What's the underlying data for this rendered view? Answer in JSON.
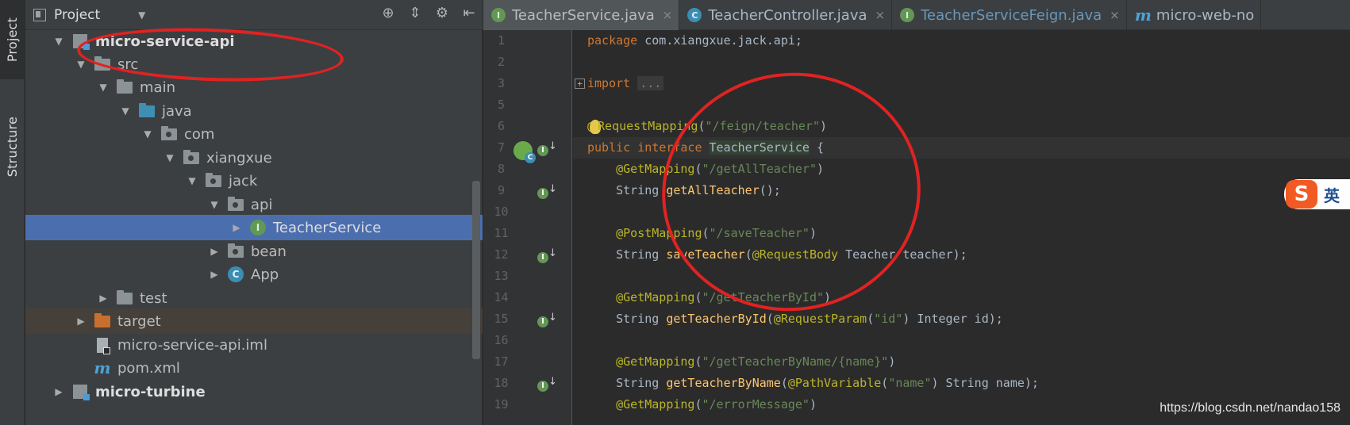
{
  "left_strip": {
    "project_tab": "Project",
    "structure_tab": "Structure"
  },
  "project_panel": {
    "title": "Project",
    "tree": [
      {
        "label": "micro-service-api",
        "icon": "module-folder-icon",
        "expanded": true,
        "bold": true
      },
      {
        "label": "src",
        "icon": "folder-icon",
        "expanded": true
      },
      {
        "label": "main",
        "icon": "folder-icon",
        "expanded": true
      },
      {
        "label": "java",
        "icon": "source-root-folder-icon",
        "expanded": true
      },
      {
        "label": "com",
        "icon": "package-icon",
        "expanded": true
      },
      {
        "label": "xiangxue",
        "icon": "package-icon",
        "expanded": true
      },
      {
        "label": "jack",
        "icon": "package-icon",
        "expanded": true
      },
      {
        "label": "api",
        "icon": "package-icon",
        "expanded": true
      },
      {
        "label": "TeacherService",
        "icon": "interface-icon",
        "selected": true
      },
      {
        "label": "bean",
        "icon": "package-icon"
      },
      {
        "label": "App",
        "icon": "spring-class-icon"
      },
      {
        "label": "test",
        "icon": "folder-icon"
      },
      {
        "label": "target",
        "icon": "excluded-folder-icon"
      },
      {
        "label": "micro-service-api.iml",
        "icon": "iml-file-icon"
      },
      {
        "label": "pom.xml",
        "icon": "maven-icon"
      },
      {
        "label": "micro-turbine",
        "icon": "module-folder-icon",
        "bold": true
      }
    ]
  },
  "editor": {
    "tabs": [
      {
        "label": "TeacherService.java",
        "icon": "interface-icon",
        "active": true,
        "close": "×"
      },
      {
        "label": "TeacherController.java",
        "icon": "class-icon",
        "close": "×"
      },
      {
        "label": "TeacherServiceFeign.java",
        "icon": "interface-icon",
        "close": "×"
      },
      {
        "label": "micro-web-no",
        "icon": "maven-icon"
      }
    ],
    "line_numbers": [
      "1",
      "2",
      "3",
      "5",
      "6",
      "7",
      "8",
      "9",
      "10",
      "11",
      "12",
      "13",
      "14",
      "15",
      "16",
      "17",
      "18",
      "19"
    ],
    "code": {
      "l1_kw": "package",
      "l1_rest": " com.xiangxue.jack.api;",
      "l3_kw": "import",
      "l3_folded": "...",
      "l6_an_a": "@",
      "l6_an_b": "RequestMapping",
      "l6_str": "\"/feign/teacher\"",
      "l7_kw": "public interface",
      "l7_name": "TeacherService",
      "l7_rest": " {",
      "l8_an": "@GetMapping",
      "l8_str": "\"/getAllTeacher\"",
      "l9_type": "String ",
      "l9_fn": "getAllTeacher",
      "l9_rest": "();",
      "l11_an": "@PostMapping",
      "l11_str": "\"/saveTeacher\"",
      "l12_type": "String ",
      "l12_fn": "saveTeacher",
      "l12_an": "@RequestBody",
      "l12_rest": " Teacher teacher);",
      "l14_an": "@GetMapping",
      "l14_str": "\"/getTeacherById\"",
      "l15_type": "String ",
      "l15_fn": "getTeacherById",
      "l15_an": "@RequestParam",
      "l15_str": "\"id\"",
      "l15_rest": " Integer id);",
      "l17_an": "@GetMapping",
      "l17_str": "\"/getTeacherByName/{name}\"",
      "l18_type": "String ",
      "l18_fn": "getTeacherByName",
      "l18_an": "@PathVariable",
      "l18_str": "\"name\"",
      "l18_rest": " String name);",
      "l19_an": "@GetMapping",
      "l19_str": "\"/errorMessage\""
    }
  },
  "ime": {
    "label": "英"
  },
  "watermark": "https://blog.csdn.net/nandao158",
  "colors": {
    "annotation": "#e12222",
    "selection": "#4b6eaf",
    "keyword": "#cc7832",
    "annotation_code": "#bbb529",
    "string": "#6a8759",
    "function": "#ffc66d"
  }
}
